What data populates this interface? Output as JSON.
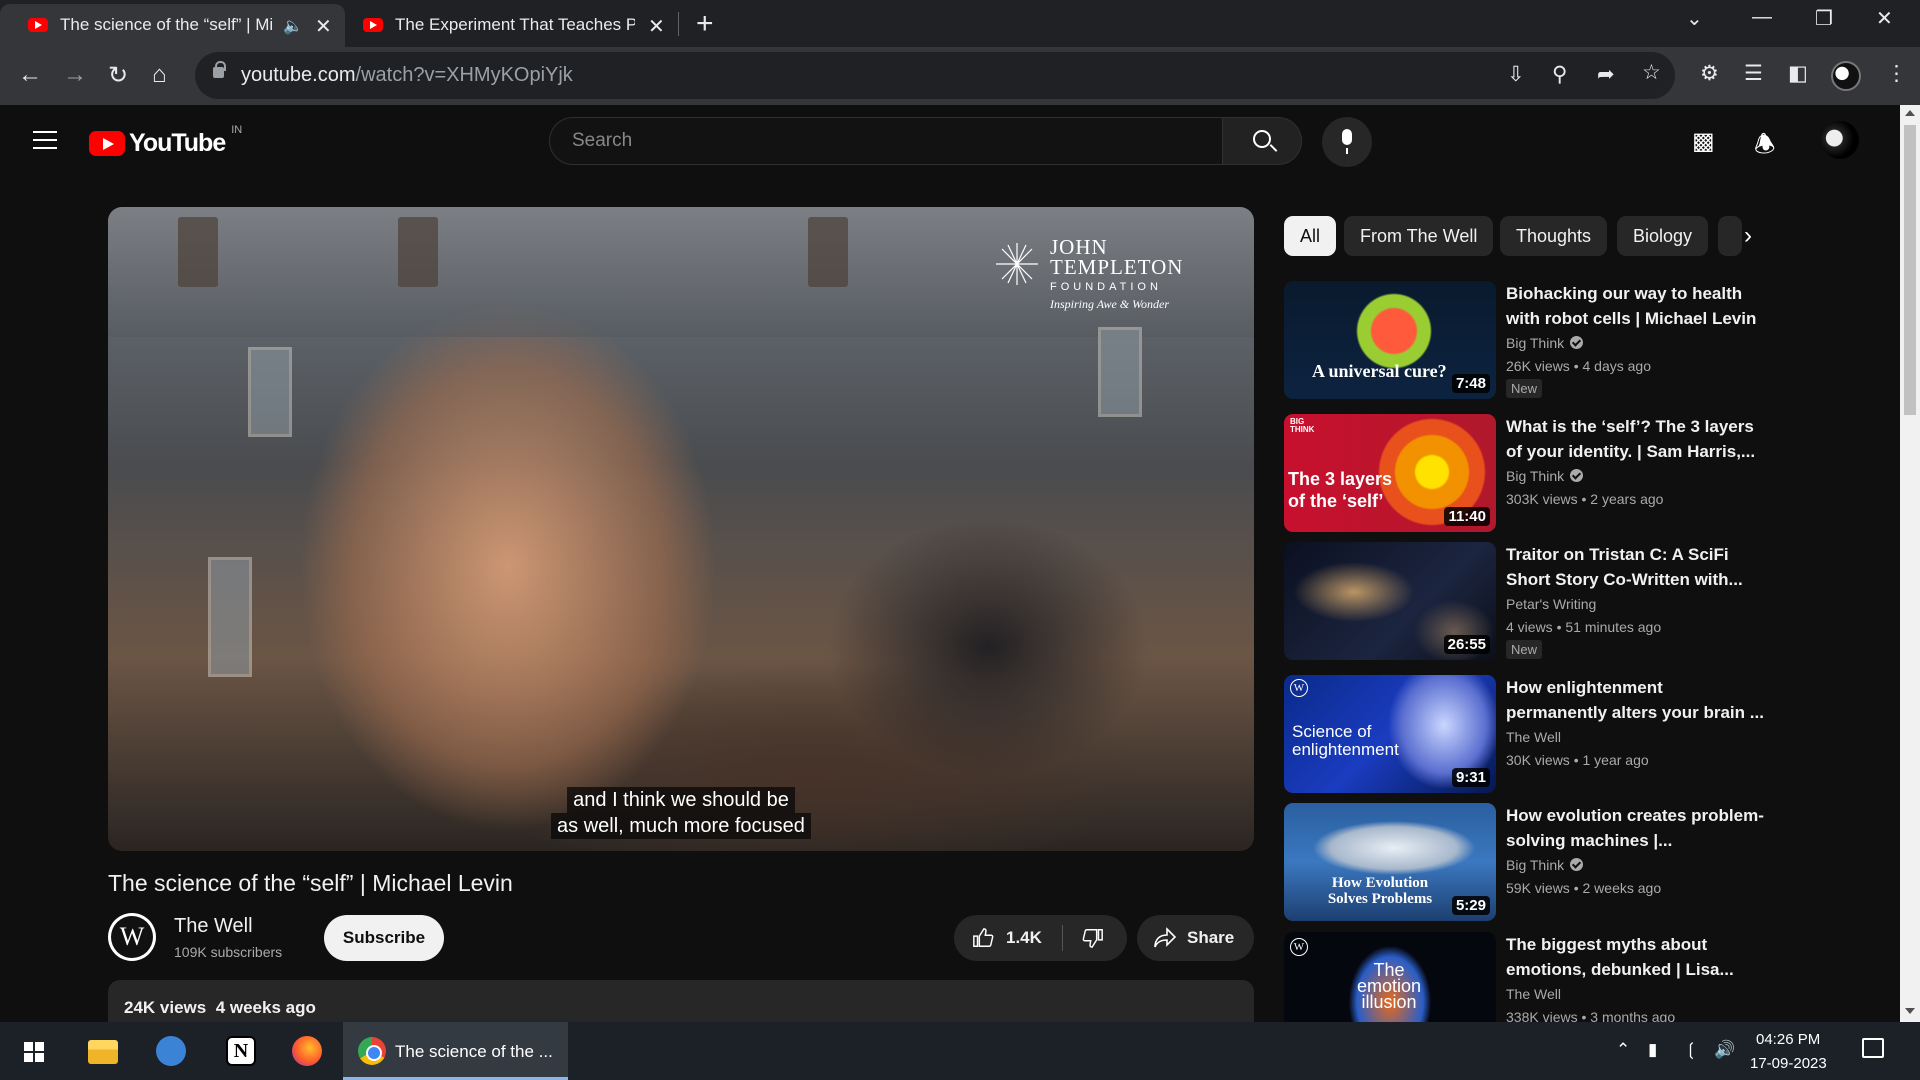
{
  "browser": {
    "tabs": [
      {
        "title": "The science of the “self” | Mi",
        "muted": true,
        "active": true
      },
      {
        "title": "The Experiment That Teaches Pec",
        "active": false
      }
    ],
    "url_host": "youtube.com",
    "url_path": "/watch?v=XHMyKOpiYjk"
  },
  "youtube": {
    "logo_text": "YouTube",
    "country_code": "IN",
    "search_placeholder": "Search"
  },
  "player": {
    "watermark": {
      "line1": "JOHN",
      "line2": "TEMPLETON",
      "line3": "FOUNDATION",
      "line4": "Inspiring Awe & Wonder"
    },
    "captions": [
      "and I think we should be",
      "as well, much more focused"
    ]
  },
  "video": {
    "title": "The science of the “self” | Michael Levin",
    "channel_name": "The Well",
    "subscribers": "109K subscribers",
    "subscribe_label": "Subscribe",
    "likes": "1.4K",
    "share_label": "Share",
    "views": "24K views",
    "age": "4 weeks ago"
  },
  "chips": [
    "All",
    "From The Well",
    "Thoughts",
    "Biology"
  ],
  "recommendations": [
    {
      "title": "Biohacking our way to health with robot cells | Michael Levin",
      "channel": "Big Think",
      "verified": true,
      "views": "26K views",
      "age": "4 days ago",
      "duration": "7:48",
      "badge": "New",
      "thumb_text": "A universal cure?"
    },
    {
      "title": "What is the ‘self’? The 3 layers of your identity. | Sam Harris,...",
      "channel": "Big Think",
      "verified": true,
      "views": "303K views",
      "age": "2 years ago",
      "duration": "11:40",
      "badge": "",
      "thumb_text": "The 3 layers of the ‘self’"
    },
    {
      "title": "Traitor on Tristan C: A SciFi Short Story Co-Written with...",
      "channel": "Petar's Writing",
      "verified": false,
      "views": "4 views",
      "age": "51 minutes ago",
      "duration": "26:55",
      "badge": "New",
      "thumb_text": ""
    },
    {
      "title": "How enlightenment permanently alters your brain ...",
      "channel": "The Well",
      "verified": false,
      "views": "30K views",
      "age": "1 year ago",
      "duration": "9:31",
      "badge": "",
      "thumb_text": "Science of enlightenment"
    },
    {
      "title": "How evolution creates problem-solving machines |...",
      "channel": "Big Think",
      "verified": true,
      "views": "59K views",
      "age": "2 weeks ago",
      "duration": "5:29",
      "badge": "",
      "thumb_text": "How Evolution Solves Problems"
    },
    {
      "title": "The biggest myths about emotions, debunked | Lisa...",
      "channel": "The Well",
      "verified": false,
      "views": "338K views",
      "age": "3 months ago",
      "duration": "",
      "badge": "",
      "thumb_text": "The emotion illusion"
    }
  ],
  "taskbar": {
    "chrome_label": "The science of the ...",
    "time": "04:26 PM",
    "date": "17-09-2023"
  }
}
